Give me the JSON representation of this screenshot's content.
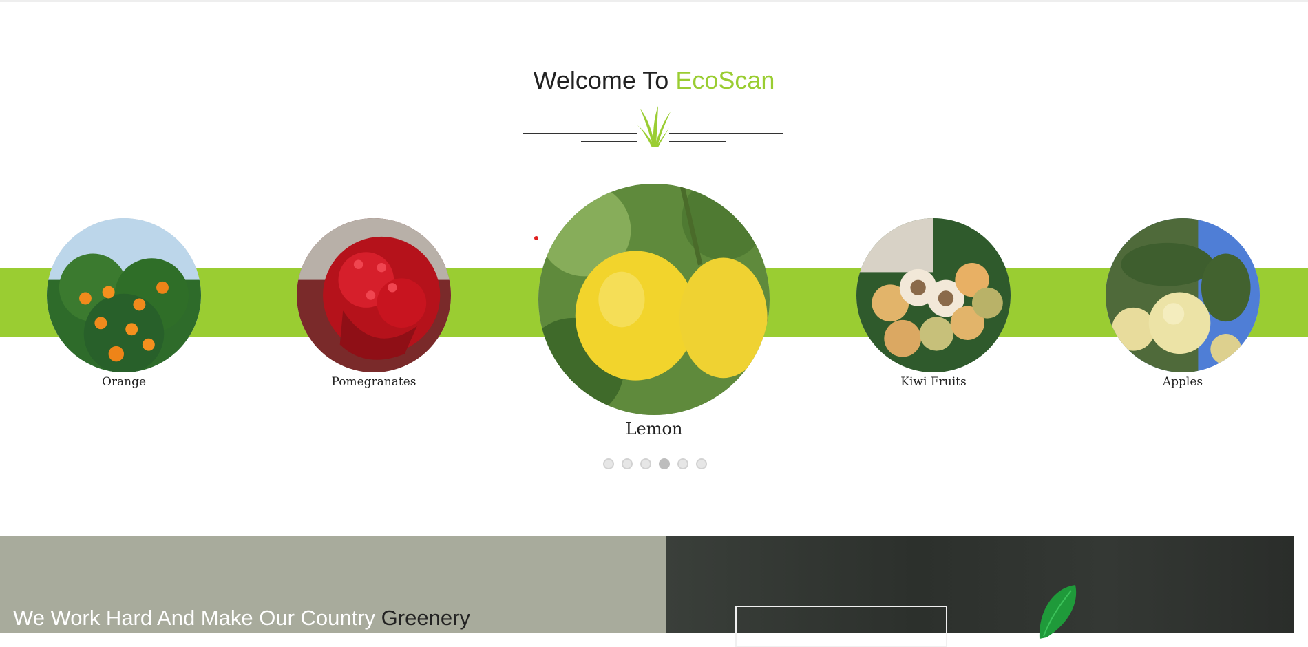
{
  "welcome": {
    "prefix": "Welcome To ",
    "brand": "EcoScan"
  },
  "carousel": {
    "items": [
      {
        "label": "Orange",
        "icon": "orange-tree-image"
      },
      {
        "label": "Pomegranates",
        "icon": "pomegranate-image"
      },
      {
        "label": "Lemon",
        "icon": "lemon-image",
        "active": true
      },
      {
        "label": "Kiwi Fruits",
        "icon": "kiwi-fruits-image"
      },
      {
        "label": "Apples",
        "icon": "apples-image"
      }
    ],
    "dots_count": 6,
    "active_dot": 4
  },
  "banner": {
    "tagline_light": "We Work Hard And Make Our Country ",
    "tagline_dark": "Greenery"
  },
  "colors": {
    "accent": "#9acd32",
    "banner_left": "#a8ab9c",
    "text": "#222222"
  }
}
